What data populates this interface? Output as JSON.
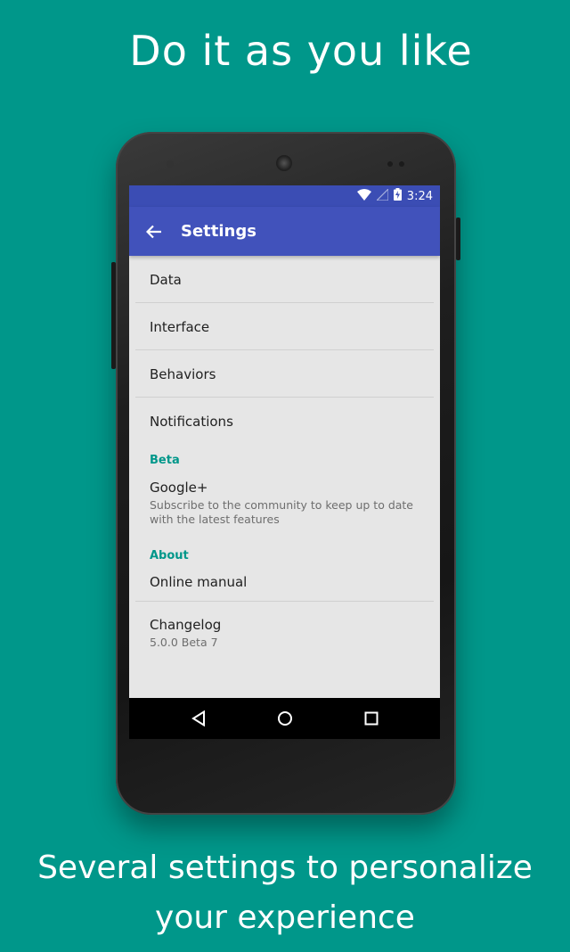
{
  "headline": "Do it as you like",
  "caption_line1": "Several settings to personalize",
  "caption_line2": "your experience",
  "status": {
    "time": "3:24"
  },
  "appbar": {
    "title": "Settings"
  },
  "items": [
    {
      "label": "Data"
    },
    {
      "label": "Interface"
    },
    {
      "label": "Behaviors"
    },
    {
      "label": "Notifications"
    }
  ],
  "beta": {
    "header": "Beta",
    "google_title": "Google+",
    "google_summary": "Subscribe to the community to keep up to date with the latest features"
  },
  "about": {
    "header": "About",
    "manual": "Online manual",
    "changelog_title": "Changelog",
    "changelog_version": "5.0.0 Beta 7"
  },
  "colors": {
    "background": "#00978a",
    "appbar": "#4152bb",
    "statusbar": "#3b4db4",
    "accent": "#00978a"
  },
  "icons": [
    "wifi-icon",
    "signal-icon",
    "battery-charging-icon",
    "back-arrow-icon",
    "nav-back-icon",
    "nav-home-icon",
    "nav-recents-icon"
  ]
}
